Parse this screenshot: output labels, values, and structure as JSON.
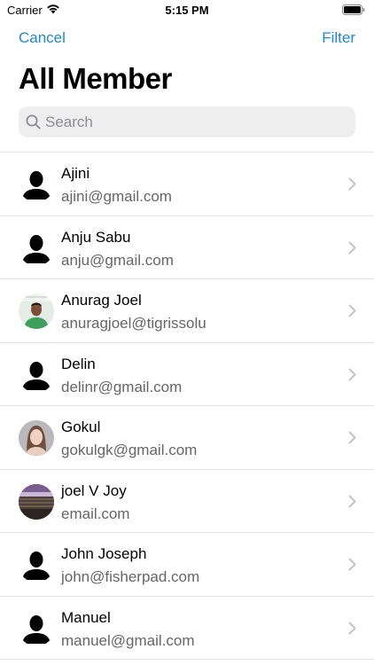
{
  "status_bar": {
    "carrier": "Carrier",
    "time": "5:15 PM"
  },
  "nav": {
    "cancel_label": "Cancel",
    "filter_label": "Filter"
  },
  "title": "All Member",
  "search": {
    "placeholder": "Search",
    "value": ""
  },
  "colors": {
    "accent": "#1e88d4",
    "secondary_text": "#666668",
    "separator": "#e2e2e4",
    "search_bg": "#eeeeef"
  },
  "members": [
    {
      "name": "Ajini",
      "email": "ajini@gmail.com",
      "avatar": "silhouette-icon"
    },
    {
      "name": "Anju Sabu",
      "email": "anju@gmail.com",
      "avatar": "silhouette-icon"
    },
    {
      "name": "Anurag Joel",
      "email": "anuragjoel@tigrissolu",
      "avatar": "photo-man-green-shirt"
    },
    {
      "name": "Delin",
      "email": "delinr@gmail.com",
      "avatar": "silhouette-icon"
    },
    {
      "name": "Gokul",
      "email": "gokulgk@gmail.com",
      "avatar": "photo-woman-portrait"
    },
    {
      "name": "joel V Joy",
      "email": "email.com",
      "avatar": "photo-landscape"
    },
    {
      "name": "John Joseph",
      "email": "john@fisherpad.com",
      "avatar": "silhouette-icon"
    },
    {
      "name": "Manuel",
      "email": "manuel@gmail.com",
      "avatar": "silhouette-icon"
    }
  ]
}
